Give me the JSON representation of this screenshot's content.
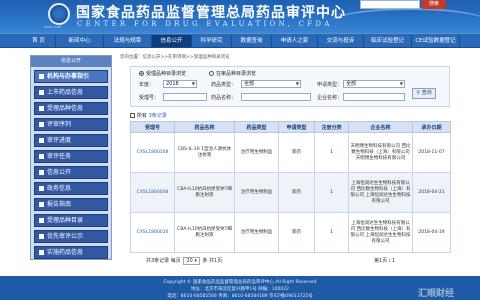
{
  "header": {
    "title_cn": "国家食品药品监督管理总局药品审评中心",
    "title_en": "CENTER FOR DRUG EVALUATION, CFDA",
    "logo_caption": "CFDA CDE",
    "search_btn": "搜索"
  },
  "nav": [
    "首 页",
    "新闻中心",
    "法规与规章",
    "信息公开",
    "科学研究",
    "数据查询",
    "申请人之家",
    "交流与投诉",
    "临床试验登记",
    "CE试验数据登记"
  ],
  "nav_active_index": 3,
  "sidebar": {
    "title": "信息公开",
    "items": [
      "机构与办事指引",
      "上市药品信息",
      "受理品种信息",
      "评审序列",
      "审评进度",
      "审评任务",
      "信息公开",
      "政务信息",
      "报告指南",
      "受理品种目录",
      "优先审评公示",
      "实施药品信息"
    ],
    "highlight_index": 0
  },
  "breadcrumb": "您的位置：信息公开>>在审项目>>受理品种目录浏览",
  "query": {
    "radio1": "受理品种目录浏览",
    "radio2": "在审品种目录浏览",
    "year_label": "年度：",
    "year_value": "2018",
    "drug_type_label": "药品类型：",
    "drug_type_value": "全部",
    "apply_type_label": "申请类型：",
    "apply_type_value": "全部",
    "accept_no_label": "受理号：",
    "drug_name_label": "药品名称：",
    "company_label": "企业名称：",
    "query_button": "查询"
  },
  "list_header": {
    "all_label": "所有",
    "count_text": "3条记录"
  },
  "table": {
    "columns": [
      "受理号",
      "药品名称",
      "药品类型",
      "申请类型",
      "注册分类",
      "企业名称",
      "承办日期"
    ],
    "rows": [
      [
        "CXSL1800108",
        "CBS-IL-1R 1型治人源抗体注射液",
        "治疗用生物制品",
        "新药",
        "1",
        "天明博生物科技有限公司 西比数生物科技（上海）有限公司 天明博生物科技有限公司",
        "2018-11-07"
      ],
      [
        "CXSL1800048",
        "CBA-IL10抗白抗原受体T细胞注射液",
        "治疗用生物制品",
        "新药",
        "1",
        "上海恒润达生生物科技有限公司 西比数生物科技（上海）有限公司 上海恒润达生生物科技有限公司",
        "2018-04-21"
      ],
      [
        "CXSL1800026",
        "CBA-IL10抗白抗原受体T细胞注射液",
        "治疗用生物制品",
        "新药",
        "1",
        "上海恒润达生生物科技有限公司 西比数生物科技（上海）有限公司 上海恒润达生生物科技有限公司",
        "2018-04-19"
      ]
    ]
  },
  "pager": {
    "left_prefix": "共3条记录 每页",
    "per_page": "20",
    "left_suffix": "条  共1页",
    "right": "第1页 / 1"
  },
  "footer": {
    "line1": "Copyright © 国家食品药品监督管理总局药品审评中心 All Right Reserved",
    "line2": "地址：北京市海淀区复兴路甲1号  邮编：100022",
    "line3": "电话：8610-68585566  传真：8610-68584189  京ICP备09013725号"
  },
  "watermark": "汇眼财经"
}
